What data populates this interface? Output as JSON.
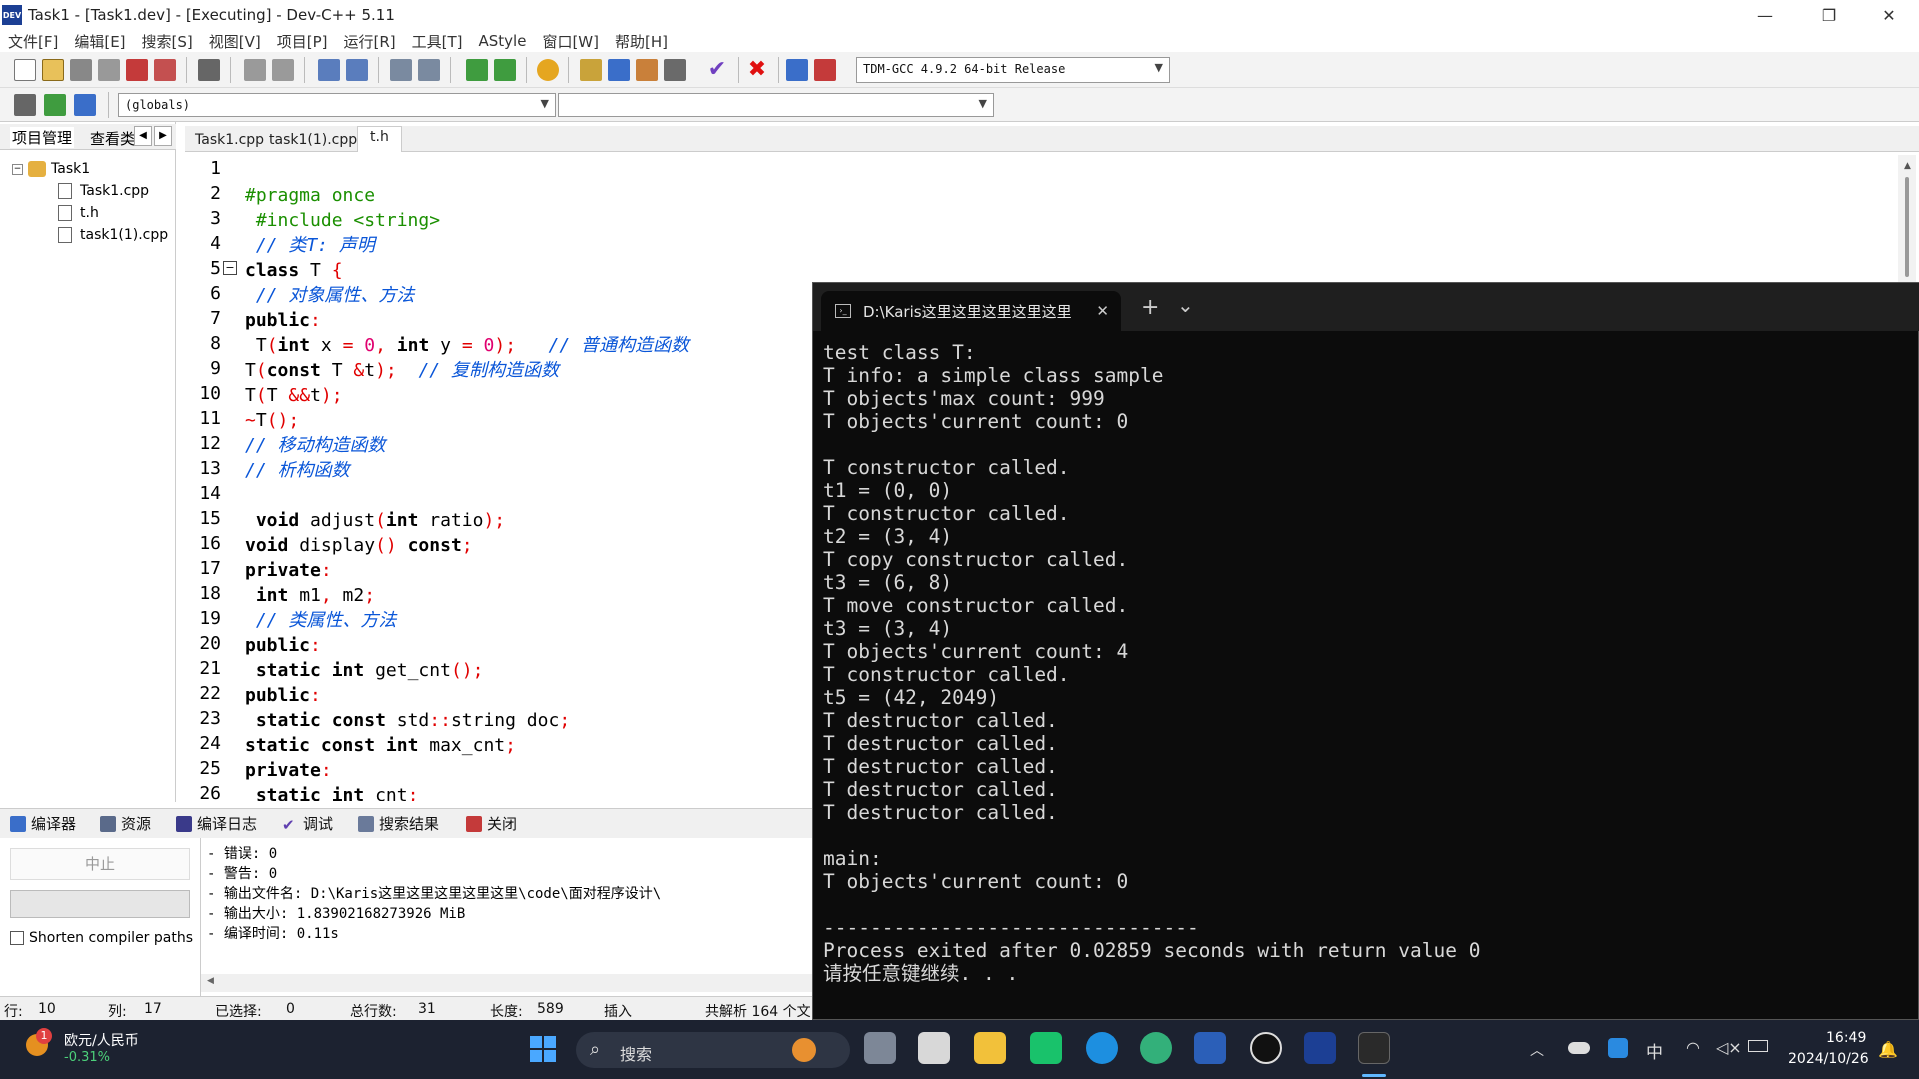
{
  "window": {
    "title": "Task1 - [Task1.dev] - [Executing] - Dev-C++ 5.11",
    "app_icon_text": "DEV",
    "minimize": "—",
    "restore": "❐",
    "close": "✕"
  },
  "menu": [
    "文件[F]",
    "编辑[E]",
    "搜索[S]",
    "视图[V]",
    "项目[P]",
    "运行[R]",
    "工具[T]",
    "AStyle",
    "窗口[W]",
    "帮助[H]"
  ],
  "toolbar": {
    "compiler_select": "TDM-GCC 4.9.2 64-bit Release",
    "scope_select": "(globals)",
    "member_select": ""
  },
  "left_panel": {
    "tabs": [
      "项目管理",
      "查看类"
    ],
    "project": "Task1",
    "files": [
      "Task1.cpp",
      "t.h",
      "task1(1).cpp"
    ]
  },
  "editor": {
    "tabs": [
      "Task1.cpp",
      "task1(1).cpp",
      "t.h"
    ],
    "active_tab": "t.h",
    "line_numbers": [
      "1",
      "2",
      "3",
      "4",
      "5",
      "6",
      "7",
      "8",
      "9",
      "10",
      "11",
      "12",
      "13",
      "14",
      "15",
      "16",
      "17",
      "18",
      "19",
      "20",
      "21",
      "22",
      "23",
      "24",
      "25",
      "26"
    ],
    "lines": [
      "",
      "#pragma once",
      " #include <string>",
      " // 类T: 声明",
      "class T {",
      " // 对象属性、方法",
      "public:",
      " T(int x = 0, int y = 0);   // 普通构造函数",
      "T(const T &t);  // 复制构造函数",
      "T(T &&t);",
      "~T();",
      "// 移动构造函数",
      "// 析构函数",
      "",
      " void adjust(int ratio);",
      "void display() const;",
      "private:",
      " int m1, m2;",
      " // 类属性、方法",
      "public:",
      " static int get_cnt();",
      "public:",
      " static const std::string doc;",
      "static const int max_cnt;",
      "private:",
      " static int cnt;"
    ],
    "highlight_line": 10
  },
  "bottom": {
    "tabs": [
      "编译器",
      "资源",
      "编译日志",
      "调试",
      "搜索结果",
      "关闭"
    ],
    "abort_button": "中止",
    "shorten_paths_label": "Shorten compiler paths",
    "log": [
      "- 错误: 0",
      "- 警告: 0",
      "- 输出文件名: D:\\Karis这里这里这里这里这里\\code\\面对程序设计\\",
      "- 输出大小: 1.83902168273926 MiB",
      "- 编译时间: 0.11s"
    ]
  },
  "statusbar": {
    "row_label": "行:",
    "row_value": "10",
    "col_label": "列:",
    "col_value": "17",
    "sel_label": "已选择:",
    "sel_value": "0",
    "total_label": "总行数:",
    "total_value": "31",
    "len_label": "长度:",
    "len_value": "589",
    "mode": "插入",
    "parsed": "共解析 164 个文"
  },
  "terminal": {
    "tab_title": "D:\\Karis这里这里这里这里这里",
    "new_tab": "+",
    "dropdown": "⌄",
    "close_tab": "✕",
    "output": "test class T:\nT info: a simple class sample\nT objects'max count: 999\nT objects'current count: 0\n\nT constructor called.\nt1 = (0, 0)\nT constructor called.\nt2 = (3, 4)\nT copy constructor called.\nt3 = (6, 8)\nT move constructor called.\nt3 = (3, 4)\nT objects'current count: 4\nT constructor called.\nt5 = (42, 2049)\nT destructor called.\nT destructor called.\nT destructor called.\nT destructor called.\nT destructor called.\n\nmain:\nT objects'current count: 0\n\n--------------------------------\nProcess exited after 0.02859 seconds with return value 0\n请按任意键继续. . ."
  },
  "taskbar": {
    "widget_badge": "1",
    "widget_title": "欧元/人民币",
    "widget_value": "-0.31%",
    "search_placeholder": "搜索",
    "tray_ime": "中",
    "time": "16:49",
    "date": "2024/10/26"
  },
  "colors": {
    "highlight_line": "#d6f8fb",
    "comment": "#0a56d8",
    "preprocessor": "#1a8f00",
    "number": "#e0006f",
    "taskbar": "#1c2230",
    "terminal_bg": "#0c0c0c"
  }
}
